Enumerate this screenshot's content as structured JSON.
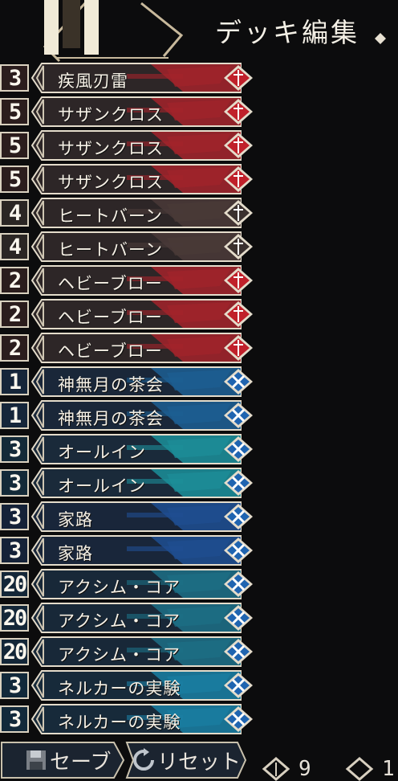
{
  "header": {
    "title": "デッキ編集"
  },
  "cards": [
    {
      "count": "3",
      "name": "疾風刃雷",
      "element": "red"
    },
    {
      "count": "5",
      "name": "サザンクロス",
      "element": "red"
    },
    {
      "count": "5",
      "name": "サザンクロス",
      "element": "red"
    },
    {
      "count": "5",
      "name": "サザンクロス",
      "element": "red"
    },
    {
      "count": "4",
      "name": "ヒートバーン",
      "element": "gray"
    },
    {
      "count": "4",
      "name": "ヒートバーン",
      "element": "gray"
    },
    {
      "count": "2",
      "name": "ヘビーブロー",
      "element": "red"
    },
    {
      "count": "2",
      "name": "ヘビーブロー",
      "element": "red"
    },
    {
      "count": "2",
      "name": "ヘビーブロー",
      "element": "red"
    },
    {
      "count": "1",
      "name": "神無月の茶会",
      "element": "blue"
    },
    {
      "count": "1",
      "name": "神無月の茶会",
      "element": "blue"
    },
    {
      "count": "3",
      "name": "オールイン",
      "element": "teal"
    },
    {
      "count": "3",
      "name": "オールイン",
      "element": "teal"
    },
    {
      "count": "3",
      "name": "家路",
      "element": "navy"
    },
    {
      "count": "3",
      "name": "家路",
      "element": "navy"
    },
    {
      "count": "20",
      "name": "アクシム・コア",
      "element": "steel"
    },
    {
      "count": "20",
      "name": "アクシム・コア",
      "element": "steel"
    },
    {
      "count": "20",
      "name": "アクシム・コア",
      "element": "steel"
    },
    {
      "count": "3",
      "name": "ネルカーの実験",
      "element": "cyan"
    },
    {
      "count": "3",
      "name": "ネルカーの実験",
      "element": "cyan"
    }
  ],
  "footer": {
    "save_label": "セーブ",
    "reset_label": "リセット",
    "stat_1_value": "9",
    "stat_2_value": "1"
  },
  "colors": {
    "red": "#a3232b",
    "gray": "#4a3a38",
    "blue": "#1d5f93",
    "teal": "#1c8f9a",
    "navy": "#1f4f92",
    "steel": "#1d6f86",
    "cyan": "#1a7fa3",
    "frame": "#e4dccb",
    "background": "#0c0c0d"
  }
}
